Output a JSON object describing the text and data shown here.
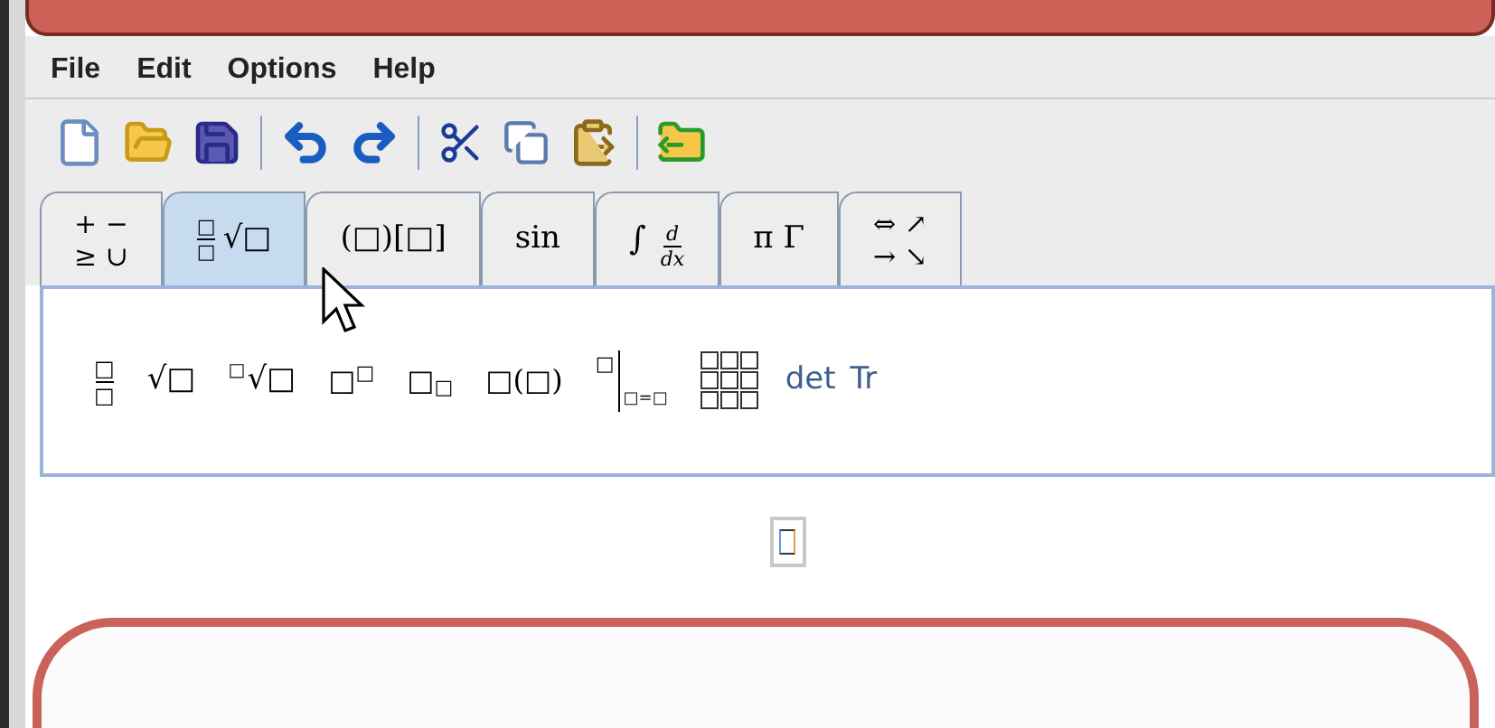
{
  "menu": [
    "File",
    "Edit",
    "Options",
    "Help"
  ],
  "tabs": [
    {
      "kind": "stack",
      "lines": [
        "+ −",
        "≥ ∪"
      ],
      "selected": false
    },
    {
      "kind": "frac_root",
      "numerator": "□",
      "denominator": "□",
      "root": "√□",
      "selected": true
    },
    {
      "kind": "text",
      "text": "(□)[□]",
      "selected": false
    },
    {
      "kind": "text",
      "text": "sin",
      "selected": false
    },
    {
      "kind": "int_deriv",
      "integral": "∫",
      "numerator": "d",
      "denominator": "dx",
      "selected": false
    },
    {
      "kind": "text",
      "text": "π Γ",
      "selected": false
    },
    {
      "kind": "stack",
      "lines": [
        "⇔ ↗",
        "→ ↘"
      ],
      "selected": false
    }
  ],
  "palette": [
    {
      "kind": "frac",
      "numerator": "□",
      "denominator": "□"
    },
    {
      "kind": "root",
      "radicand": "√□"
    },
    {
      "kind": "nthroot",
      "index": "□",
      "radicand": "√□"
    },
    {
      "kind": "sup",
      "base": "□",
      "script": "□"
    },
    {
      "kind": "sub",
      "base": "□",
      "script": "□"
    },
    {
      "kind": "text",
      "text": "□(□)"
    },
    {
      "kind": "eval",
      "script": "□",
      "lower": "□=□"
    },
    {
      "kind": "matrix"
    },
    {
      "kind": "word",
      "text": "det"
    },
    {
      "kind": "word",
      "text": "Tr"
    }
  ]
}
